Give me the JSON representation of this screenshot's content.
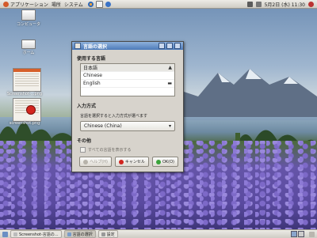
{
  "top_panel": {
    "applications": "アプリケーション",
    "places": "場所",
    "system": "システム",
    "clock": "5月2日 (水) 11:30"
  },
  "desktop": {
    "icons": [
      {
        "label": "コンピュータ"
      },
      {
        "label": "ホーム"
      }
    ],
    "thumbnails": [
      {
        "label": "Screenshot-...png"
      },
      {
        "label": "screenshot.png"
      }
    ]
  },
  "dialog": {
    "title": "言語の選択",
    "languages_section_title": "使用する言語",
    "languages": [
      {
        "name": "日本語",
        "selected": true,
        "symbol": "▲"
      },
      {
        "name": "Chinese",
        "selected": false,
        "symbol": ""
      },
      {
        "name": "English",
        "selected": false,
        "symbol": "▬"
      }
    ],
    "input_section_title": "入力方式",
    "input_hint": "言語を選択すると入力方式が選べます",
    "input_method_value": "Chinese (China)",
    "options_section_title": "その他",
    "options_checkbox_label": "すべての言語を表示する",
    "buttons": {
      "help": "ヘルプ(H)",
      "cancel": "キャンセル",
      "ok": "OK(O)"
    }
  },
  "taskbar": {
    "items": [
      {
        "label": "Screenshot-言語の...",
        "active": false
      },
      {
        "label": "言語の選択",
        "active": true
      },
      {
        "label": "設定",
        "active": false
      }
    ]
  },
  "colors": {
    "title_bar": "#4c7ab8",
    "cancel_icon": "#d0241e",
    "ok_icon": "#3aa33a"
  }
}
